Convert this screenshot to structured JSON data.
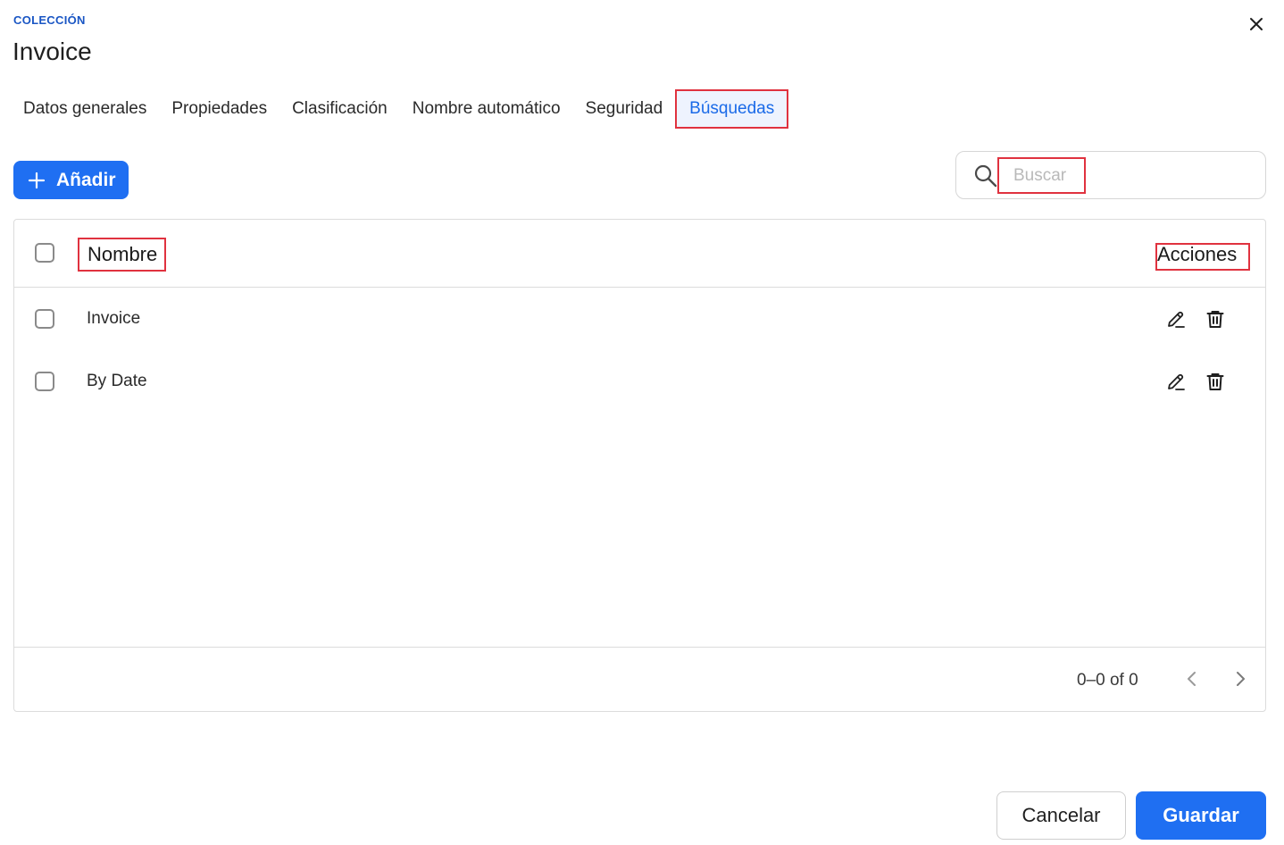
{
  "dialog": {
    "eyebrow": "COLECCIÓN",
    "title": "Invoice",
    "close_icon": "close-icon"
  },
  "tabs": [
    {
      "label": "Datos generales",
      "active": false
    },
    {
      "label": "Propiedades",
      "active": false
    },
    {
      "label": "Clasificación",
      "active": false
    },
    {
      "label": "Nombre automático",
      "active": false
    },
    {
      "label": "Seguridad",
      "active": false
    },
    {
      "label": "Búsquedas",
      "active": true
    }
  ],
  "toolbar": {
    "add_label": "Añadir",
    "add_icon": "plus-icon",
    "search_placeholder": "Buscar",
    "search_value": "",
    "search_icon": "search-icon"
  },
  "table": {
    "columns": {
      "name": "Nombre",
      "actions": "Acciones"
    },
    "rows": [
      {
        "name": "Invoice"
      },
      {
        "name": "By Date"
      }
    ],
    "pagination": {
      "text": "0–0 of 0"
    }
  },
  "footer": {
    "cancel_label": "Cancelar",
    "save_label": "Guardar"
  },
  "colors": {
    "accent": "#1f6ff2",
    "eyebrow": "#1a56c4",
    "highlight_border": "#e0323f"
  }
}
